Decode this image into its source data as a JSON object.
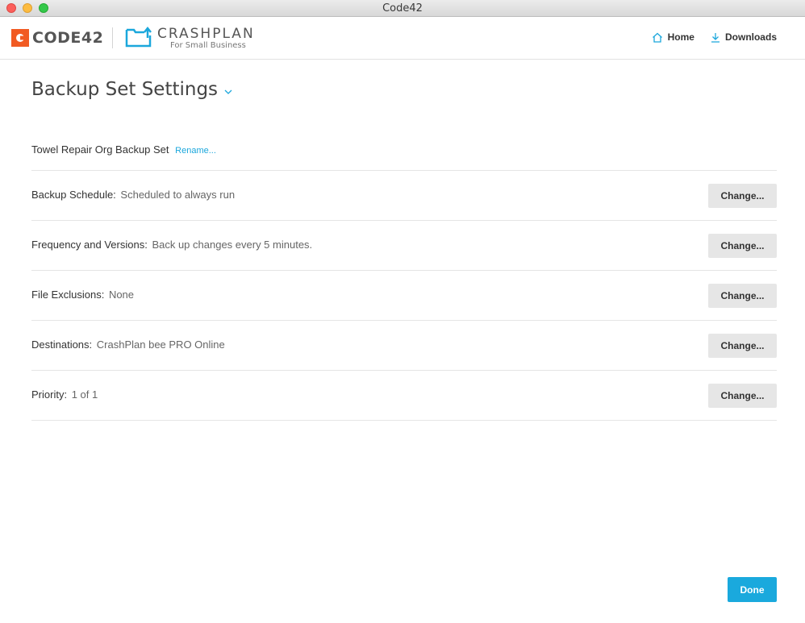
{
  "window": {
    "title": "Code42"
  },
  "header": {
    "code42_logo_text": "CODE42",
    "crashplan_name": "CRASHPLAN",
    "crashplan_sub": "For Small Business",
    "nav": {
      "home": "Home",
      "downloads": "Downloads"
    }
  },
  "page": {
    "title": "Backup Set Settings"
  },
  "backup_set": {
    "name": "Towel Repair Org Backup Set",
    "rename_label": "Rename..."
  },
  "rows": [
    {
      "label": "Backup Schedule:",
      "value": "Scheduled to always run",
      "button": "Change..."
    },
    {
      "label": "Frequency and Versions:",
      "value": "Back up changes every 5 minutes.",
      "button": "Change..."
    },
    {
      "label": "File Exclusions:",
      "value": "None",
      "button": "Change..."
    },
    {
      "label": "Destinations:",
      "value": "CrashPlan bee PRO Online",
      "button": "Change..."
    },
    {
      "label": "Priority:",
      "value": "1 of 1",
      "button": "Change..."
    }
  ],
  "footer": {
    "done_label": "Done"
  },
  "colors": {
    "accent": "#1aa9dd",
    "code42_orange": "#f15a22",
    "crashplan_blue": "#1ba7dc"
  },
  "icons": {
    "home": "home-icon",
    "downloads": "download-icon",
    "title_dropdown": "chevron-down-icon"
  }
}
